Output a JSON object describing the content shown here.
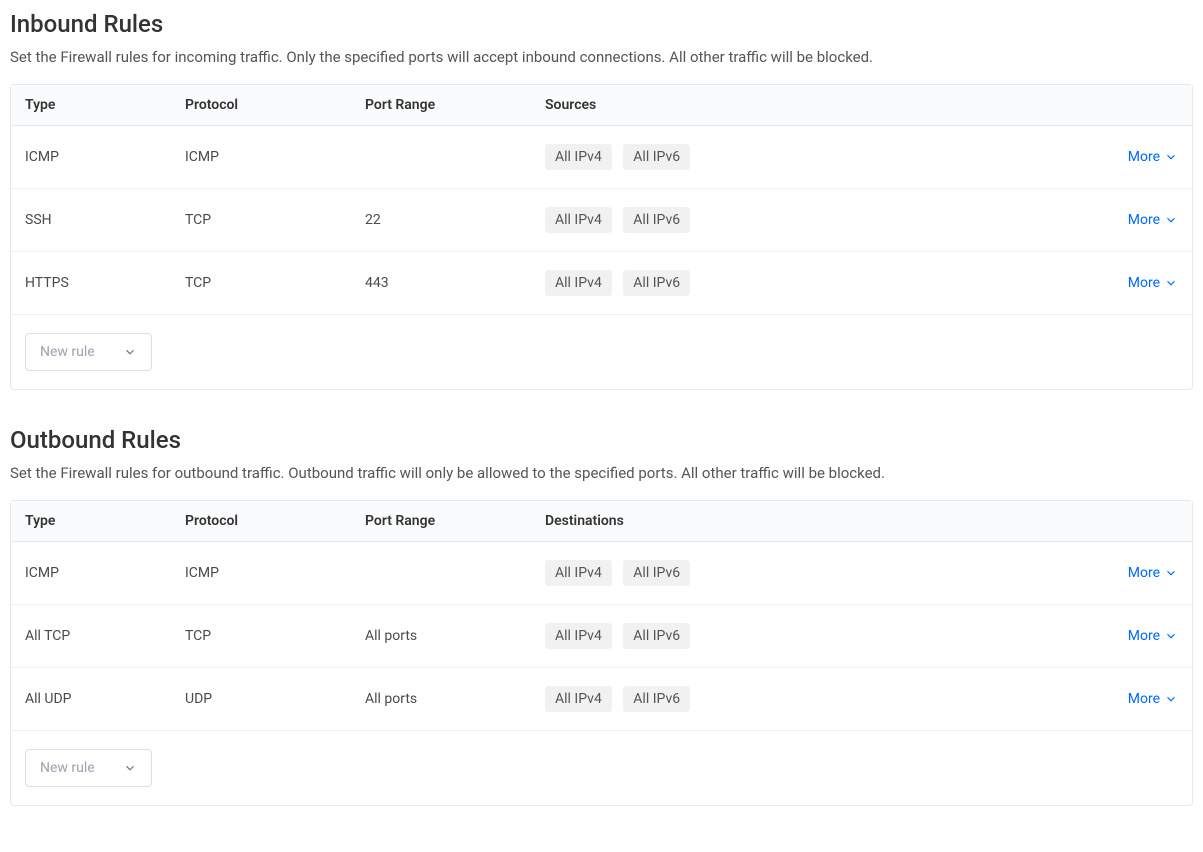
{
  "inbound": {
    "title": "Inbound Rules",
    "description": "Set the Firewall rules for incoming traffic. Only the specified ports will accept inbound connections. All other traffic will be blocked.",
    "headers": {
      "type": "Type",
      "protocol": "Protocol",
      "portRange": "Port Range",
      "sources": "Sources"
    },
    "rows": [
      {
        "type": "ICMP",
        "protocol": "ICMP",
        "portRange": "",
        "tags": [
          "All IPv4",
          "All IPv6"
        ]
      },
      {
        "type": "SSH",
        "protocol": "TCP",
        "portRange": "22",
        "tags": [
          "All IPv4",
          "All IPv6"
        ]
      },
      {
        "type": "HTTPS",
        "protocol": "TCP",
        "portRange": "443",
        "tags": [
          "All IPv4",
          "All IPv6"
        ]
      }
    ],
    "newRulePlaceholder": "New rule",
    "moreLabel": "More"
  },
  "outbound": {
    "title": "Outbound Rules",
    "description": "Set the Firewall rules for outbound traffic. Outbound traffic will only be allowed to the specified ports. All other traffic will be blocked.",
    "headers": {
      "type": "Type",
      "protocol": "Protocol",
      "portRange": "Port Range",
      "destinations": "Destinations"
    },
    "rows": [
      {
        "type": "ICMP",
        "protocol": "ICMP",
        "portRange": "",
        "tags": [
          "All IPv4",
          "All IPv6"
        ]
      },
      {
        "type": "All TCP",
        "protocol": "TCP",
        "portRange": "All ports",
        "tags": [
          "All IPv4",
          "All IPv6"
        ]
      },
      {
        "type": "All UDP",
        "protocol": "UDP",
        "portRange": "All ports",
        "tags": [
          "All IPv4",
          "All IPv6"
        ]
      }
    ],
    "newRulePlaceholder": "New rule",
    "moreLabel": "More"
  }
}
